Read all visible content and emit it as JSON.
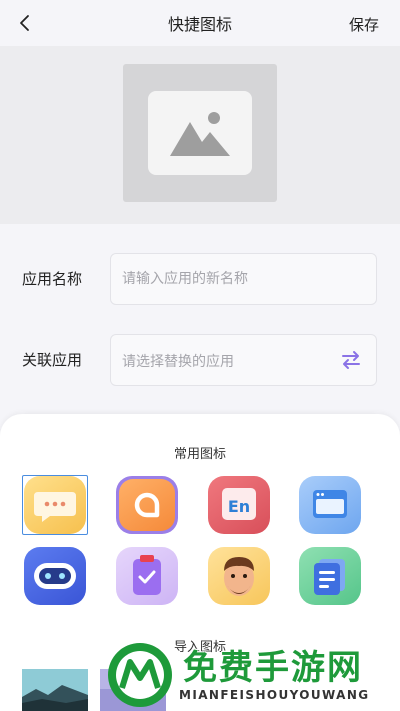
{
  "header": {
    "title": "快捷图标",
    "save_label": "保存",
    "back_icon": "chevron-left-icon"
  },
  "preview": {
    "icon": "image-placeholder-icon"
  },
  "form": {
    "name_label": "应用名称",
    "name_placeholder": "请输入应用的新名称",
    "name_value": "",
    "app_label": "关联应用",
    "app_placeholder": "请选择替换的应用",
    "swap_icon": "swap-icon"
  },
  "icons_sheet": {
    "common_title": "常用图标",
    "common_icons": [
      {
        "name": "chat-bubble-icon",
        "selected": true
      },
      {
        "name": "letter-a-icon",
        "selected": false
      },
      {
        "name": "english-en-icon",
        "selected": false
      },
      {
        "name": "browser-window-icon",
        "selected": false
      },
      {
        "name": "robot-icon",
        "selected": false
      },
      {
        "name": "clipboard-check-icon",
        "selected": false
      },
      {
        "name": "avatar-face-icon",
        "selected": false
      },
      {
        "name": "notes-icon",
        "selected": false
      }
    ],
    "import_title": "导入图标"
  },
  "watermark": {
    "title": "免费手游网",
    "subtitle": "MIANFEISHOUYOUWANG"
  },
  "colors": {
    "accent_blue": "#4a8de0",
    "swap_purple": "#8b73e6",
    "watermark_green": "#1e9a3a"
  }
}
